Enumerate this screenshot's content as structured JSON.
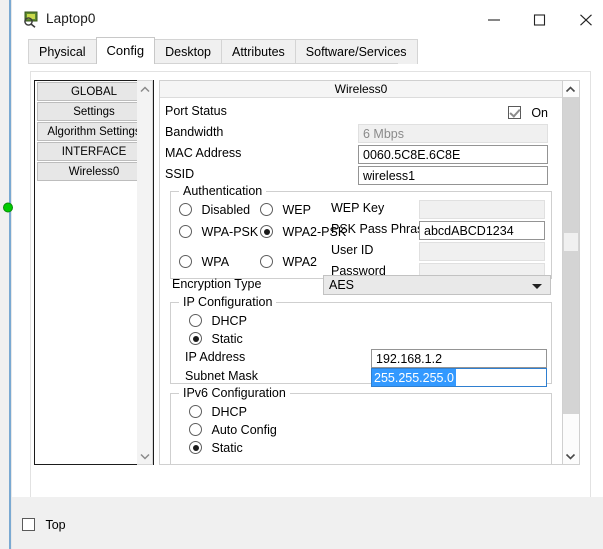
{
  "window": {
    "title": "Laptop0",
    "icon": "packet-tracer-device-icon",
    "minimize_label": "–",
    "maximize_label": "□",
    "close_label": "✕"
  },
  "tabs": [
    {
      "label": "Physical",
      "active": false
    },
    {
      "label": "Config",
      "active": true
    },
    {
      "label": "Desktop",
      "active": false
    },
    {
      "label": "Attributes",
      "active": false
    },
    {
      "label": "Software/Services",
      "active": false
    }
  ],
  "tree": {
    "items": [
      {
        "label": "GLOBAL",
        "kind": "category"
      },
      {
        "label": "Settings",
        "kind": "item"
      },
      {
        "label": "Algorithm Settings",
        "kind": "item"
      },
      {
        "label": "INTERFACE",
        "kind": "category"
      },
      {
        "label": "Wireless0",
        "kind": "item"
      }
    ],
    "scroll_up_icon": "chevron-up-icon",
    "scroll_down_icon": "chevron-down-icon"
  },
  "pane": {
    "header": "Wireless0",
    "scroll_up_icon": "chevron-up-icon",
    "scroll_down_icon": "chevron-down-icon"
  },
  "fields": {
    "port_status_label": "Port Status",
    "port_status_on_label": "On",
    "port_status_checked": true,
    "bandwidth_label": "Bandwidth",
    "bandwidth_value": "6 Mbps",
    "mac_label": "MAC Address",
    "mac_value": "0060.5C8E.6C8E",
    "ssid_label": "SSID",
    "ssid_value": "wireless1"
  },
  "authentication": {
    "title": "Authentication",
    "options": [
      {
        "label": "Disabled",
        "selected": false
      },
      {
        "label": "WEP",
        "selected": false
      },
      {
        "label": "WPA-PSK",
        "selected": false
      },
      {
        "label": "WPA2-PSK",
        "selected": true
      },
      {
        "label": "WPA",
        "selected": false
      },
      {
        "label": "WPA2",
        "selected": false
      }
    ],
    "wep_key_label": "WEP Key",
    "wep_key_value": "",
    "psk_label": "PSK Pass Phrase",
    "psk_value": "abcdABCD1234",
    "user_id_label": "User ID",
    "user_id_value": "",
    "password_label": "Password",
    "password_value": ""
  },
  "encryption": {
    "label": "Encryption Type",
    "value": "AES",
    "dropdown_icon": "chevron-down-icon"
  },
  "ip_config": {
    "title": "IP Configuration",
    "dhcp_label": "DHCP",
    "dhcp_selected": false,
    "static_label": "Static",
    "static_selected": true,
    "ip_label": "IP Address",
    "ip_value": "192.168.1.2",
    "mask_label": "Subnet Mask",
    "mask_value": "255.255.255.0",
    "mask_focused": true,
    "mask_selected": true
  },
  "ipv6_config": {
    "title": "IPv6 Configuration",
    "dhcp_label": "DHCP",
    "dhcp_selected": false,
    "auto_label": "Auto Config",
    "auto_selected": false,
    "static_label": "Static",
    "static_selected": true
  },
  "footer": {
    "top_label": "Top",
    "top_checked": false
  },
  "colors": {
    "selection_blue": "#3399ff",
    "focus_border": "#2f7fd0",
    "window_accent": "#7aa9d2",
    "port_green": "#00cc00"
  }
}
